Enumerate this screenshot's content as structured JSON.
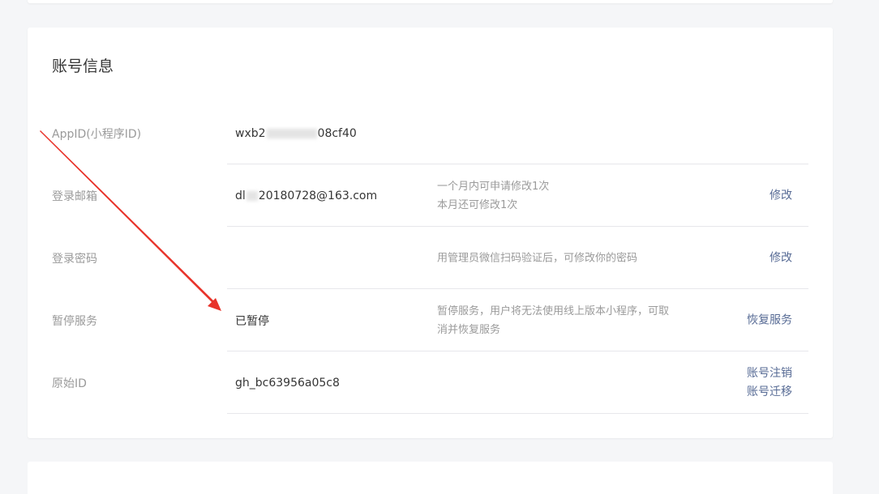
{
  "section": {
    "title": "账号信息"
  },
  "rows": [
    {
      "label": "AppID(小程序ID)",
      "value_prefix": "wxb2",
      "value_suffix": "08cf40"
    },
    {
      "label": "登录邮箱",
      "value_prefix": "dl",
      "value_suffix": "20180728@163.com",
      "desc": [
        "一个月内可申请修改1次",
        "本月还可修改1次"
      ],
      "actions": [
        "修改"
      ]
    },
    {
      "label": "登录密码",
      "desc": [
        "用管理员微信扫码验证后，可修改你的密码"
      ],
      "actions": [
        "修改"
      ]
    },
    {
      "label": "暂停服务",
      "value": "已暂停",
      "desc": [
        "暂停服务，用户将无法使用线上版本小程序，可取",
        "消并恢复服务"
      ],
      "actions": [
        "恢复服务"
      ]
    },
    {
      "label": "原始ID",
      "value": "gh_bc63956a05c8",
      "actions": [
        "账号注销",
        "账号迁移"
      ]
    }
  ],
  "colors": {
    "link": "#576b95",
    "annotation_arrow": "#e8332a"
  }
}
